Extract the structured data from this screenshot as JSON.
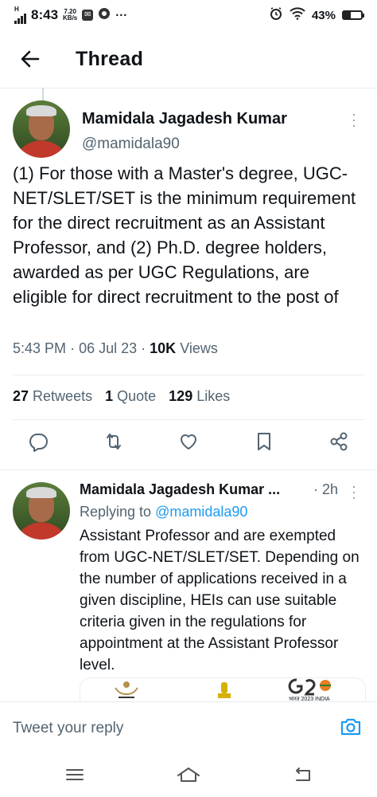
{
  "status": {
    "network": "H",
    "time": "8:43",
    "speed_value": "7.20",
    "speed_unit": "KB/s",
    "dots": "···",
    "battery": "43%",
    "battery_level": 0.43
  },
  "header": {
    "title": "Thread"
  },
  "tweet": {
    "name": "Mamidala Jagadesh Kumar",
    "handle": "@mamidala90",
    "text": "(1) For those with a Master's degree, UGC-NET/SLET/SET is the minimum requirement for the direct recruitment as an Assistant Professor, and (2) Ph.D. degree holders, awarded as per UGC Regulations, are eligible for direct recruitment to the post of",
    "time": "5:43 PM",
    "date": "06 Jul 23",
    "views_count": "10K",
    "views_label": "Views",
    "retweets_count": "27",
    "retweets_label": "Retweets",
    "quotes_count": "1",
    "quotes_label": "Quote",
    "likes_count": "129",
    "likes_label": "Likes"
  },
  "reply": {
    "name": "Mamidala Jagadesh Kumar ...",
    "age": "· 2h",
    "replying_prefix": "Replying to",
    "replying_handle": "@mamidala90",
    "text": "Assistant Professor and are exempted from UGC-NET/SLET/SET. Depending on the number of applications received in a given discipline, HEIs can use suitable criteria given in the regulations for appointment at the Assistant Professor level.",
    "card_badge": "भारत 2023 INDIA"
  },
  "composer": {
    "placeholder": "Tweet your reply"
  },
  "icons": {
    "accent": "#1d9bf0",
    "text_secondary": "#536471"
  }
}
